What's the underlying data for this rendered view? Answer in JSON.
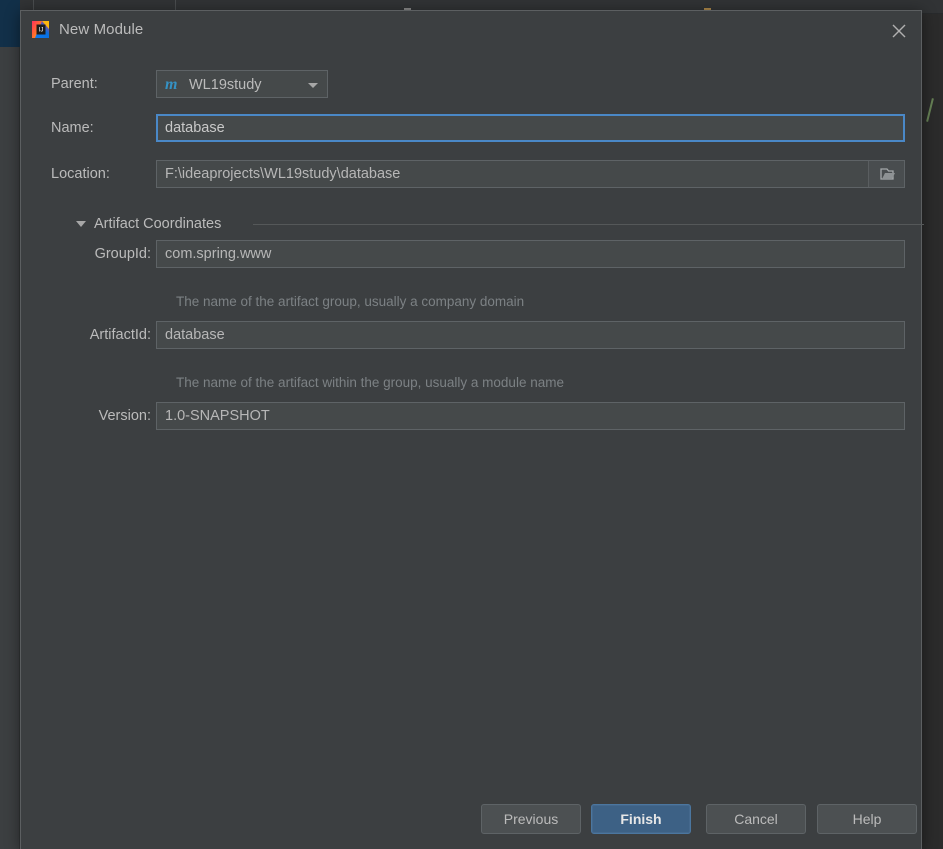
{
  "dialog": {
    "title": "New Module",
    "title_icon": "intellij-idea-icon",
    "close_icon": "close-icon"
  },
  "form": {
    "parent": {
      "label": "Parent:",
      "value": "WL19study",
      "icon": "maven-module-icon",
      "arrow_icon": "chevron-down-icon"
    },
    "name": {
      "label": "Name:",
      "value": "database",
      "placeholder": "",
      "focused": true
    },
    "location": {
      "label": "Location:",
      "value": "F:\\ideaprojects\\WL19study\\database",
      "placeholder": "",
      "browse_icon": "folder-icon"
    }
  },
  "artifact_section": {
    "title": "Artifact Coordinates",
    "expanded": true,
    "twisty_icon": "chevron-down-icon",
    "group_id": {
      "label": "GroupId:",
      "value": "com.spring.www",
      "hint": "The name of the artifact group, usually a company domain"
    },
    "artifact_id": {
      "label": "ArtifactId:",
      "value": "database",
      "hint": "The name of the artifact within the group, usually a module name"
    },
    "version": {
      "label": "Version:",
      "value": "1.0-SNAPSHOT"
    }
  },
  "footer": {
    "previous": "Previous",
    "finish": "Finish",
    "cancel": "Cancel",
    "help": "Help"
  },
  "colors": {
    "dialog_background": "#3c3f41",
    "field_background": "#45494a",
    "focus_border": "#4a88c7",
    "primary_button": "#3d6185",
    "text": "#bbbbbb",
    "hint_text": "#7c8184",
    "maven_icon": "#3592c4"
  }
}
